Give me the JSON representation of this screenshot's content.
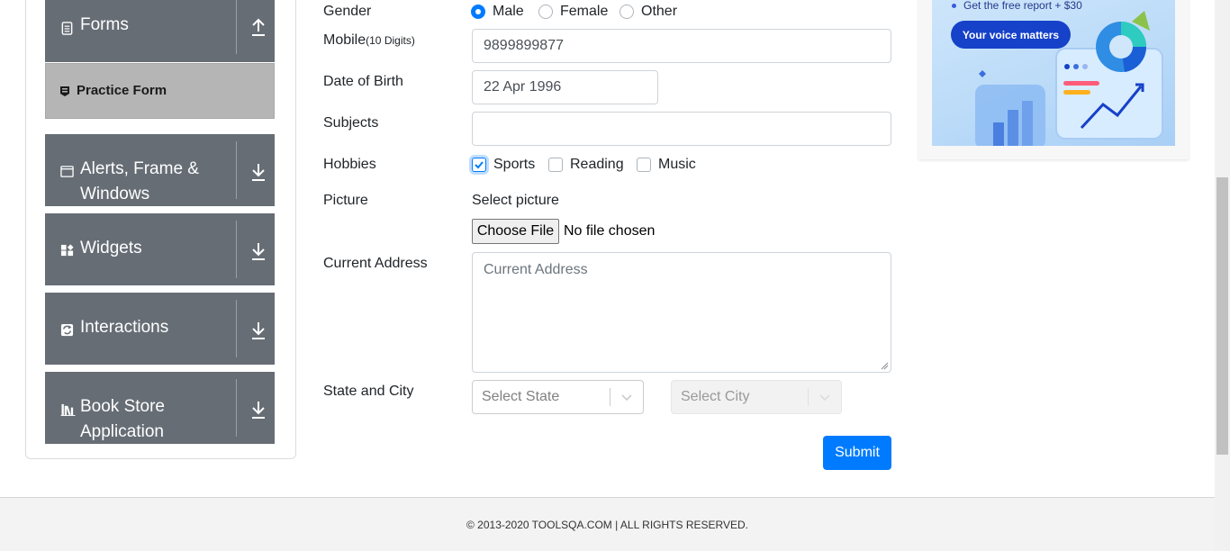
{
  "sidebar": {
    "groups": [
      {
        "label": "Forms",
        "icon": "document-icon",
        "arrow": "up"
      },
      {
        "label": "Alerts, Frame &",
        "label2": "Windows",
        "icon": "window-icon",
        "arrow": "down"
      },
      {
        "label": "Widgets",
        "icon": "widgets-icon",
        "arrow": "down"
      },
      {
        "label": "Interactions",
        "icon": "interactions-icon",
        "arrow": "down"
      },
      {
        "label": "Book Store",
        "label2": "Application",
        "icon": "books-icon",
        "arrow": "down"
      }
    ],
    "active_item": {
      "label": "Practice Form",
      "icon": "form-icon"
    }
  },
  "form": {
    "gender": {
      "label": "Gender",
      "options": [
        "Male",
        "Female",
        "Other"
      ],
      "selected": "Male"
    },
    "mobile": {
      "label": "Mobile",
      "hint": "(10 Digits)",
      "value": "9899899877"
    },
    "dob": {
      "label": "Date of Birth",
      "value": "22 Apr 1996"
    },
    "subjects": {
      "label": "Subjects",
      "value": ""
    },
    "hobbies": {
      "label": "Hobbies",
      "options": [
        "Sports",
        "Reading",
        "Music"
      ],
      "checked": [
        "Sports"
      ]
    },
    "picture": {
      "label": "Picture",
      "caption": "Select picture",
      "button": "Choose File",
      "status": "No file chosen"
    },
    "address": {
      "label": "Current Address",
      "placeholder": "Current Address"
    },
    "state_city": {
      "label": "State and City",
      "state_placeholder": "Select State",
      "city_placeholder": "Select City"
    },
    "submit": "Submit"
  },
  "ad": {
    "text": "Get the free report + $30",
    "button": "Your voice matters"
  },
  "footer": {
    "text": "© 2013-2020 TOOLSQA.COM | ALL RIGHTS RESERVED."
  },
  "colors": {
    "sidebar_bg": "#666d75",
    "active_bg": "#b5b5b5",
    "primary": "#007bff",
    "ad_button": "#1641c9"
  }
}
